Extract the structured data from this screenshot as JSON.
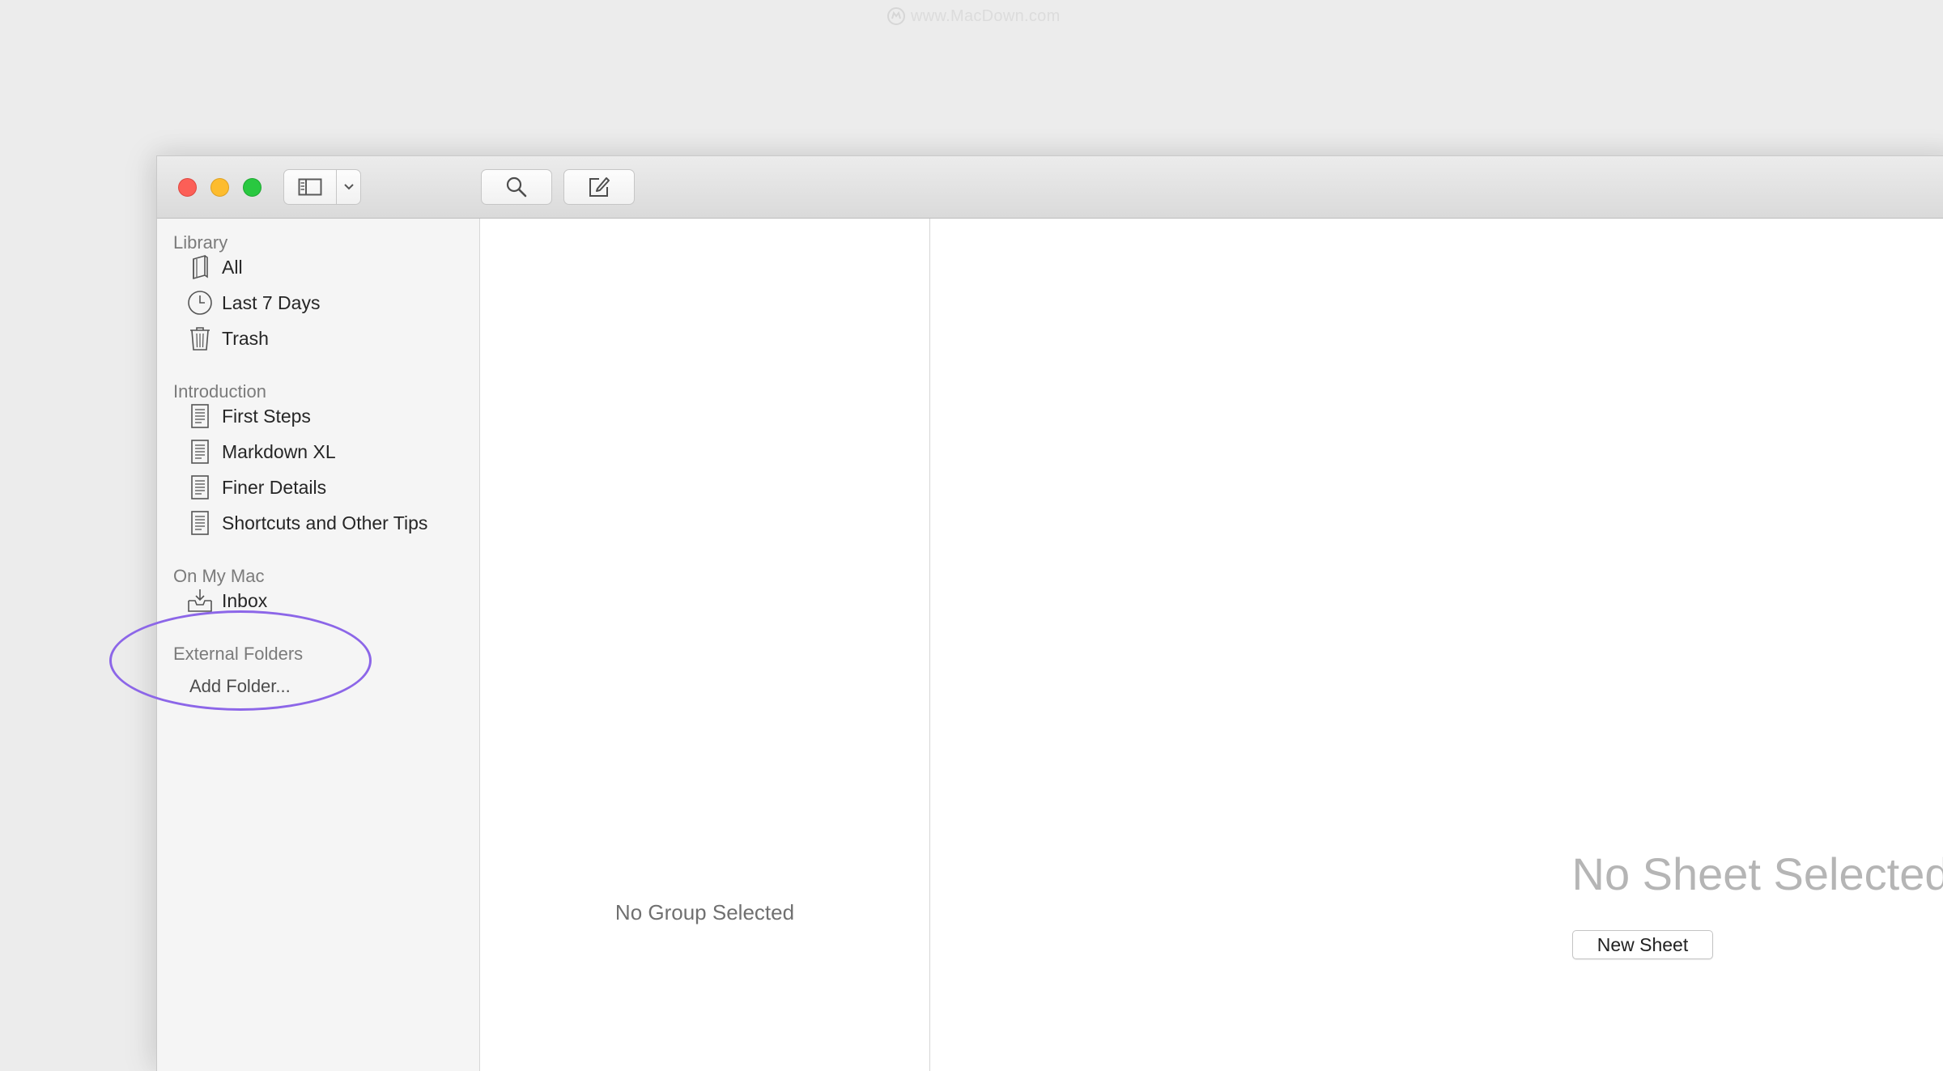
{
  "watermark": {
    "text": "www.MacDown.com",
    "icon": "macdown-logo-icon"
  },
  "window": {
    "traffic_lights": [
      "close",
      "minimize",
      "zoom"
    ],
    "toolbar": {
      "sidebar_toggle_icon": "sidebar-icon",
      "dropdown_icon": "chevron-down-icon",
      "search_icon": "search-icon",
      "compose_icon": "compose-icon"
    }
  },
  "sidebar": {
    "library": {
      "header": "Library",
      "items": [
        {
          "label": "All",
          "icon": "book-icon"
        },
        {
          "label": "Last 7 Days",
          "icon": "clock-icon"
        },
        {
          "label": "Trash",
          "icon": "trash-icon"
        }
      ]
    },
    "introduction": {
      "header": "Introduction",
      "items": [
        {
          "label": "First Steps",
          "icon": "document-icon"
        },
        {
          "label": "Markdown XL",
          "icon": "document-icon"
        },
        {
          "label": "Finer Details",
          "icon": "document-icon"
        },
        {
          "label": "Shortcuts and Other Tips",
          "icon": "document-icon"
        }
      ]
    },
    "on_my_mac": {
      "header": "On My Mac",
      "items": [
        {
          "label": "Inbox",
          "icon": "inbox-icon"
        }
      ]
    },
    "external_folders": {
      "header": "External Folders",
      "add_label": "Add Folder..."
    }
  },
  "list_pane": {
    "empty_text": "No Group Selected"
  },
  "editor_pane": {
    "empty_title": "No Sheet Selected",
    "new_sheet_label": "New Sheet"
  },
  "colors": {
    "highlight_oval": "#8c66e8",
    "close": "#fc5f57",
    "minimize": "#fdbc2e",
    "zoom": "#29c840"
  }
}
